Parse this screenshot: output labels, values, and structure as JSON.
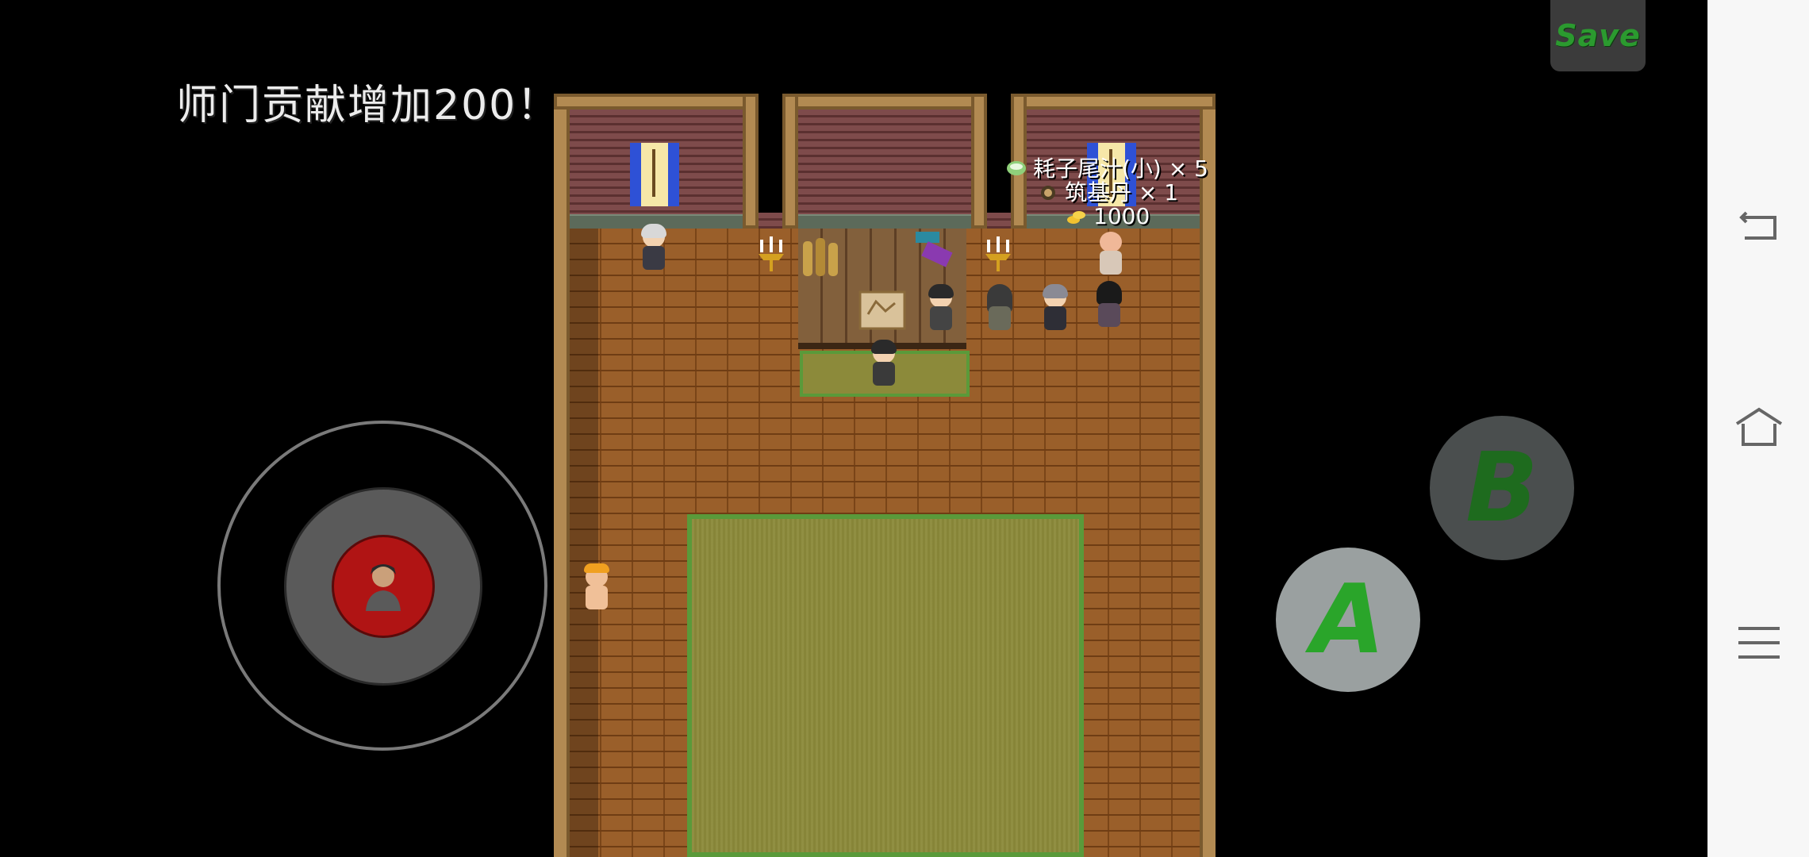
{
  "message": "师门贡献增加200！",
  "save_button": {
    "label": "Save"
  },
  "items": [
    {
      "icon": "juice-bowl-icon",
      "text": "耗子尾汁(小) × 5",
      "color": "#8fcf7a"
    },
    {
      "icon": "pill-icon",
      "text": "筑基丹 × 1",
      "color": "#c9a46a"
    },
    {
      "icon": "gold-coins-icon",
      "text": "1000",
      "color": "#f2c230"
    }
  ],
  "controls": {
    "a_button": "A",
    "b_button": "B",
    "a_color": "#2aa52a",
    "b_color": "#1e6b1e"
  },
  "colors": {
    "floor": "#9a5f2a",
    "rug": "#8c8a3a",
    "rug_border": "#5a9a3a",
    "joystick_knob": "#b01414"
  },
  "nav": {
    "back": "back-icon",
    "home": "home-icon",
    "menu": "menu-icon"
  }
}
